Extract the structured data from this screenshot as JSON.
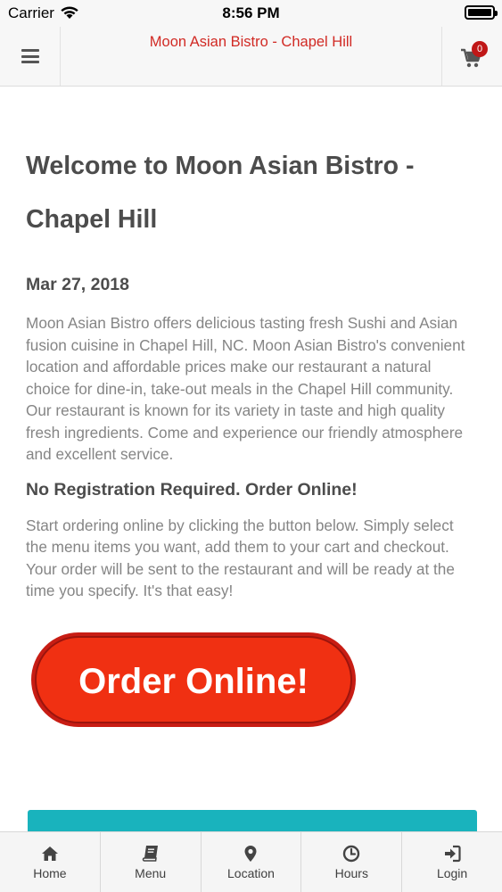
{
  "status_bar": {
    "carrier": "Carrier",
    "time": "8:56 PM"
  },
  "header": {
    "title": "Moon Asian Bistro - Chapel Hill",
    "cart_count": "0"
  },
  "content": {
    "title": "Welcome to Moon Asian Bistro - Chapel Hill",
    "date": "Mar 27, 2018",
    "intro": "Moon Asian Bistro offers delicious tasting fresh Sushi and Asian fusion cuisine in Chapel Hill, NC.  Moon Asian Bistro's convenient location and affordable prices make our restaurant a natural choice for dine-in, take-out meals in the Chapel Hill community.  Our restaurant is known for its variety in taste and high quality fresh ingredients. Come and experience our friendly atmosphere and excellent service.",
    "subheading": "No Registration Required. Order Online!",
    "instructions": "Start ordering online by clicking the button below. Simply select the menu items you want, add them to your cart and checkout. Your order will be sent to the restaurant and will be ready at the time you specify. It's that easy!",
    "order_button_label": "Order Online!"
  },
  "tabs": [
    {
      "label": "Home",
      "icon": "home-icon"
    },
    {
      "label": "Menu",
      "icon": "book-icon"
    },
    {
      "label": "Location",
      "icon": "map-pin-icon"
    },
    {
      "label": "Hours",
      "icon": "clock-icon"
    },
    {
      "label": "Login",
      "icon": "sign-in-icon"
    }
  ],
  "colors": {
    "accent_red": "#d12a24",
    "order_button_red": "#f03012",
    "teal_banner": "#19b3bd"
  }
}
